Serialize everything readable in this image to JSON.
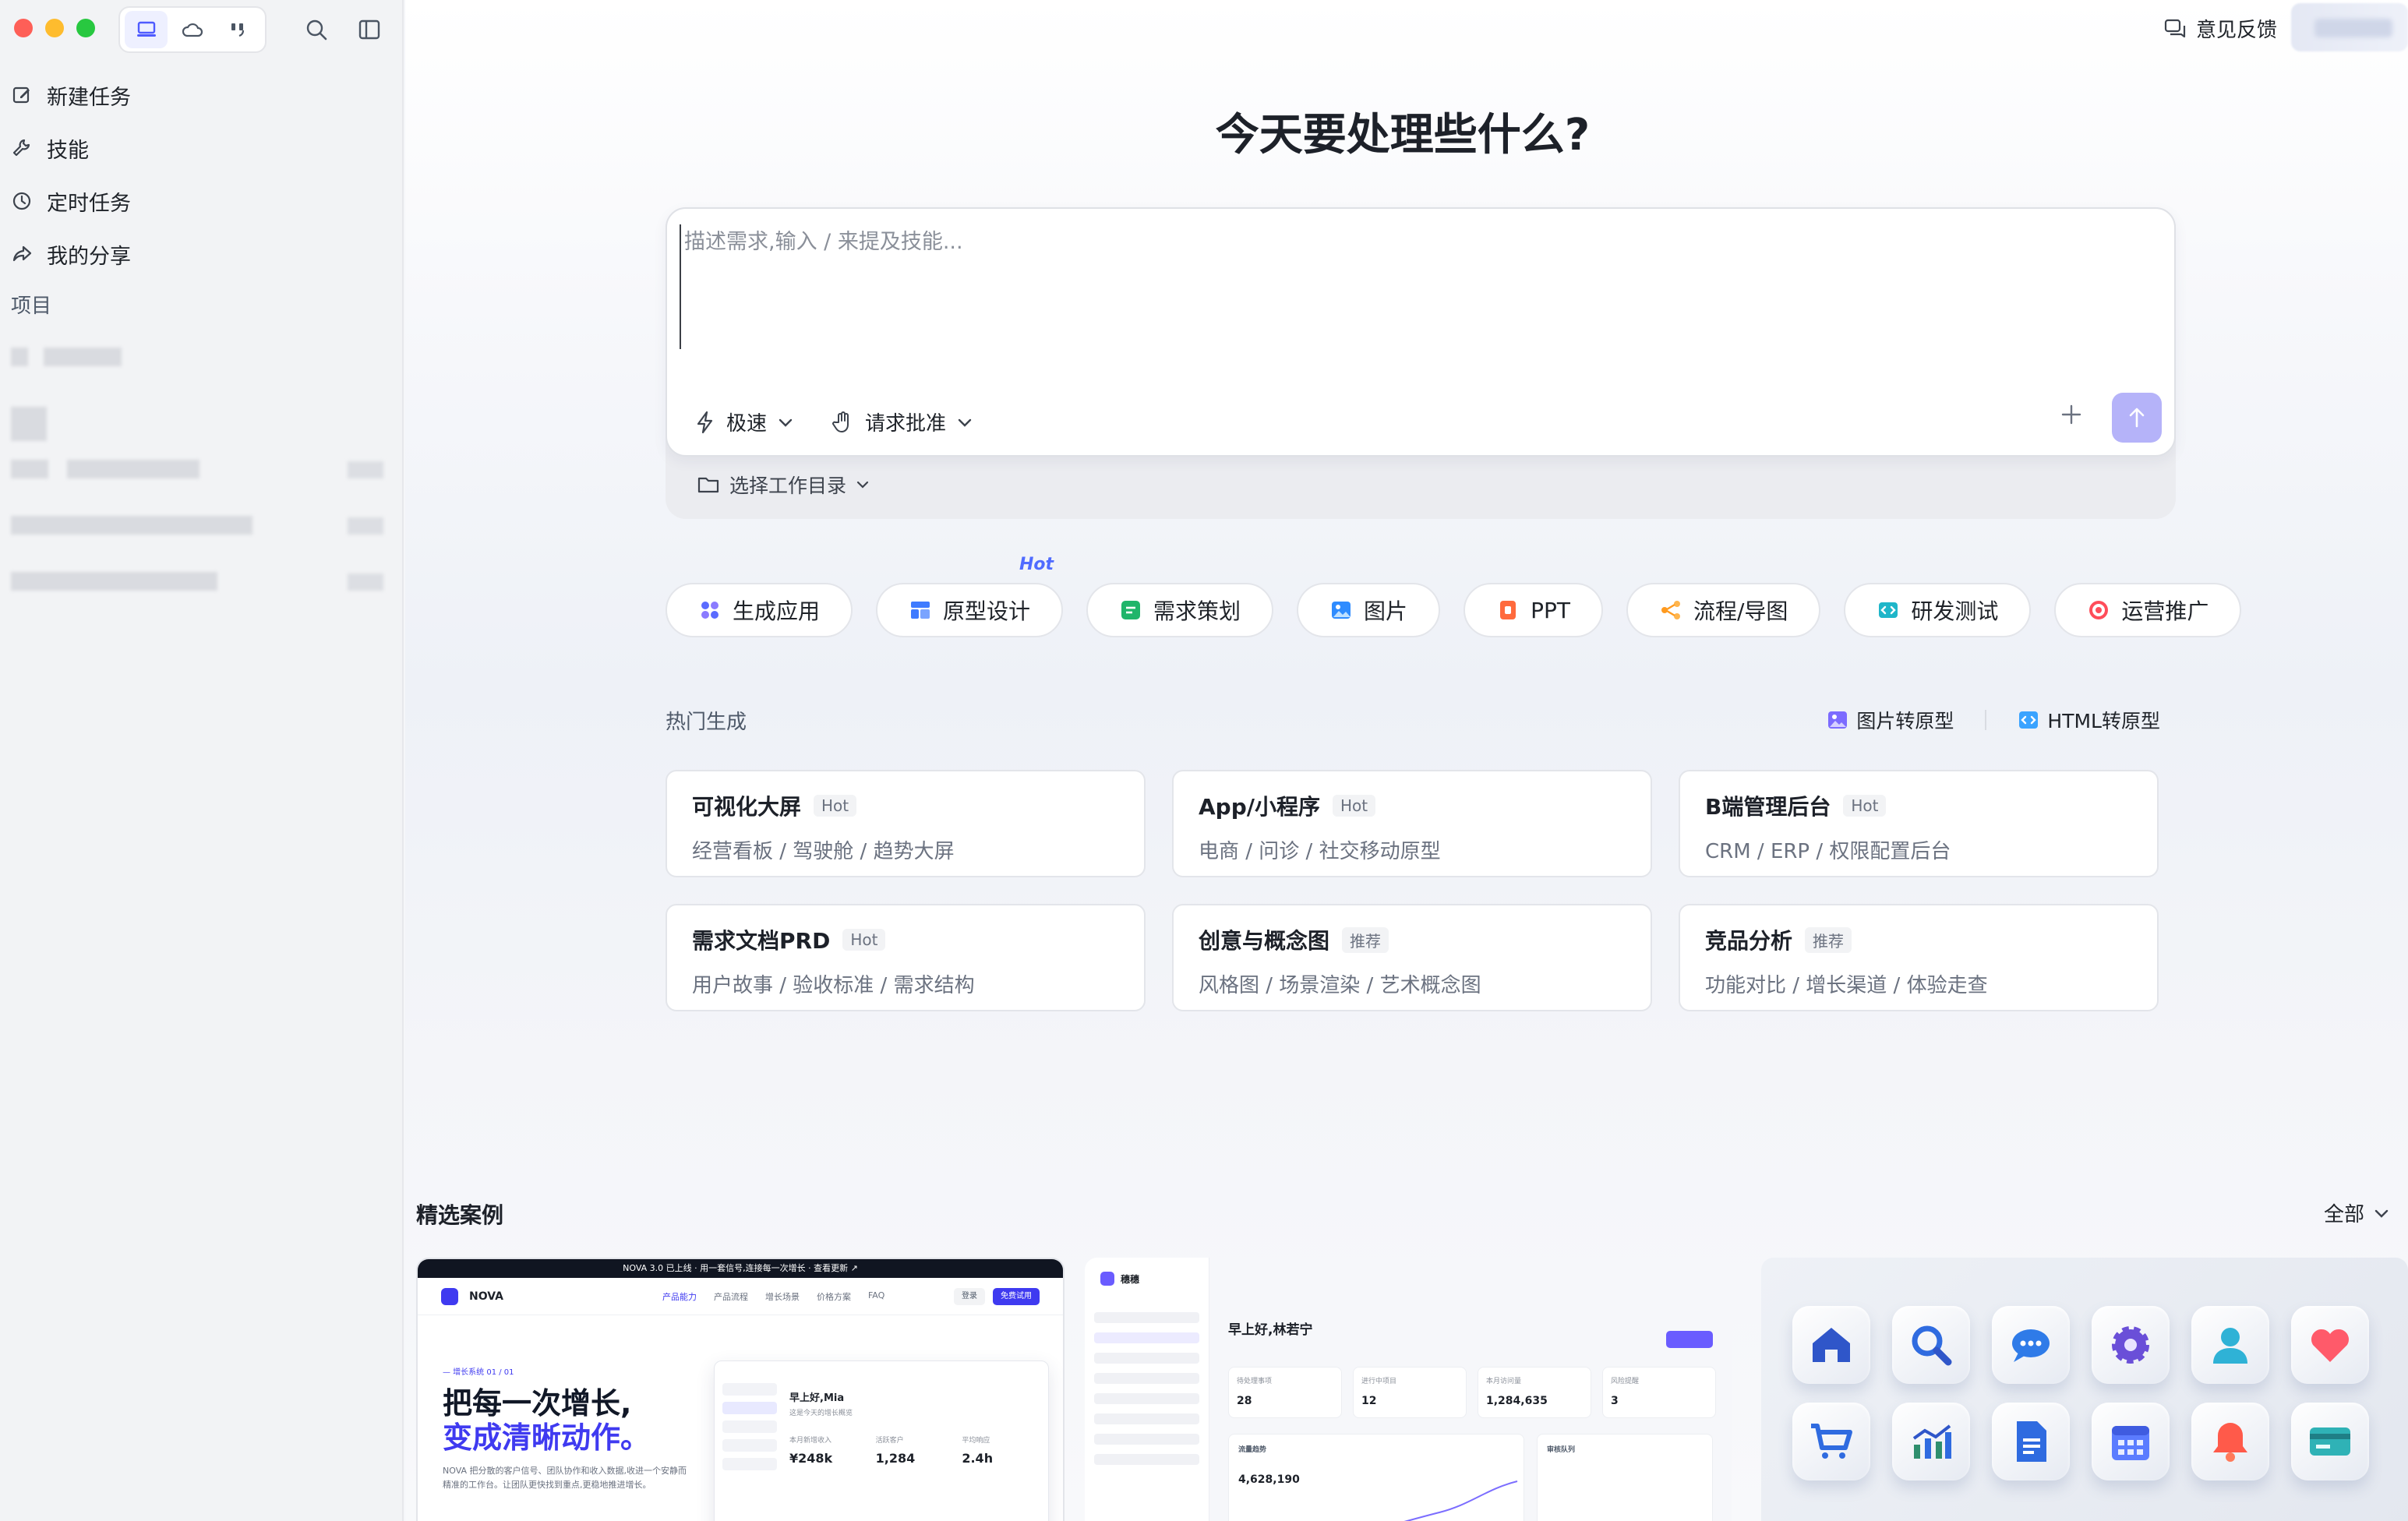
{
  "sidebar": {
    "nav": [
      {
        "label": "新建任务",
        "icon": "edit-icon"
      },
      {
        "label": "技能",
        "icon": "wrench-icon"
      },
      {
        "label": "定时任务",
        "icon": "clock-icon"
      },
      {
        "label": "我的分享",
        "icon": "share-icon"
      }
    ],
    "projects_label": "项目"
  },
  "topbar": {
    "feedback_label": "意见反馈"
  },
  "main": {
    "headline": "今天要处理些什么?",
    "composer": {
      "placeholder": "描述需求,输入 / 来提及技能...",
      "speed_label": "极速",
      "approval_label": "请求批准",
      "workdir_label": "选择工作目录"
    },
    "chips": [
      {
        "label": "生成应用",
        "icon": "apps-icon",
        "color": "#5b6cff"
      },
      {
        "label": "原型设计",
        "icon": "layout-icon",
        "color": "#3f7bff",
        "hot": "Hot"
      },
      {
        "label": "需求策划",
        "icon": "doc-list-icon",
        "color": "#1fb56a"
      },
      {
        "label": "图片",
        "icon": "image-icon",
        "color": "#2f8cff"
      },
      {
        "label": "PPT",
        "icon": "ppt-icon",
        "color": "#ff6a3d"
      },
      {
        "label": "流程/导图",
        "icon": "flow-icon",
        "color": "#ff9a1f"
      },
      {
        "label": "研发测试",
        "icon": "code-icon",
        "color": "#1fb6c9"
      },
      {
        "label": "运营推广",
        "icon": "target-icon",
        "color": "#ff4d5a"
      }
    ],
    "hot": {
      "title": "热门生成",
      "links": [
        {
          "label": "图片转原型",
          "icon": "image-to-prototype-icon"
        },
        {
          "label": "HTML转原型",
          "icon": "html-to-prototype-icon"
        }
      ],
      "cards": [
        {
          "title": "可视化大屏",
          "badge": "Hot",
          "desc": "经营看板 / 驾驶舱 / 趋势大屏"
        },
        {
          "title": "App/小程序",
          "badge": "Hot",
          "desc": "电商 / 问诊 / 社交移动原型"
        },
        {
          "title": "B端管理后台",
          "badge": "Hot",
          "desc": "CRM / ERP / 权限配置后台"
        },
        {
          "title": "需求文档PRD",
          "badge": "Hot",
          "desc": "用户故事 / 验收标准 / 需求结构"
        },
        {
          "title": "创意与概念图",
          "badge": "推荐",
          "desc": "风格图 / 场景渲染 / 艺术概念图"
        },
        {
          "title": "竞品分析",
          "badge": "推荐",
          "desc": "功能对比 / 增长渠道 / 体验走查"
        }
      ]
    },
    "featured": {
      "title": "精选案例",
      "filter_label": "全部",
      "case1": {
        "banner": "NOVA 3.0 已上线 · 用一套信号,连接每一次增长 · 查看更新 ↗",
        "brand": "NOVA",
        "links": [
          "产品能力",
          "产品流程",
          "增长场景",
          "价格方案",
          "FAQ"
        ],
        "login": "登录",
        "trial": "免费试用",
        "kicker": "— 增长系统 01 / 01",
        "headline_line1": "把每一次增长,",
        "headline_line2": "变成清晰动作。",
        "paragraph": "NOVA 把分散的客户信号、团队协作和收入数据,收进一个安静而精准的工作台。让团队更快找到重点,更稳地推进增长。",
        "greeting": "早上好,Mia",
        "sub": "这是今天的增长概览",
        "stats": [
          {
            "label": "本月新增收入",
            "value": "¥248k"
          },
          {
            "label": "活跃客户",
            "value": "1,284"
          },
          {
            "label": "平均响应",
            "value": "2.4h"
          }
        ]
      },
      "case2": {
        "brand": "穗穗",
        "greeting": "早上好,林若宁",
        "stats": [
          {
            "label": "待处理事项",
            "value": "28"
          },
          {
            "label": "进行中项目",
            "value": "12"
          },
          {
            "label": "本月访问量",
            "value": "1,284,635"
          },
          {
            "label": "风险提醒",
            "value": "3"
          }
        ],
        "panel1_label": "流量趋势",
        "panel1_value": "4,628,190",
        "panel2_label": "审核队列"
      },
      "case3": {
        "icons": [
          "home-icon",
          "search-icon",
          "chat-icon",
          "gear-icon",
          "user-icon",
          "heart-icon",
          "cart-icon",
          "chart-icon",
          "document-icon",
          "calendar-icon",
          "bell-icon",
          "card-icon"
        ]
      }
    }
  }
}
